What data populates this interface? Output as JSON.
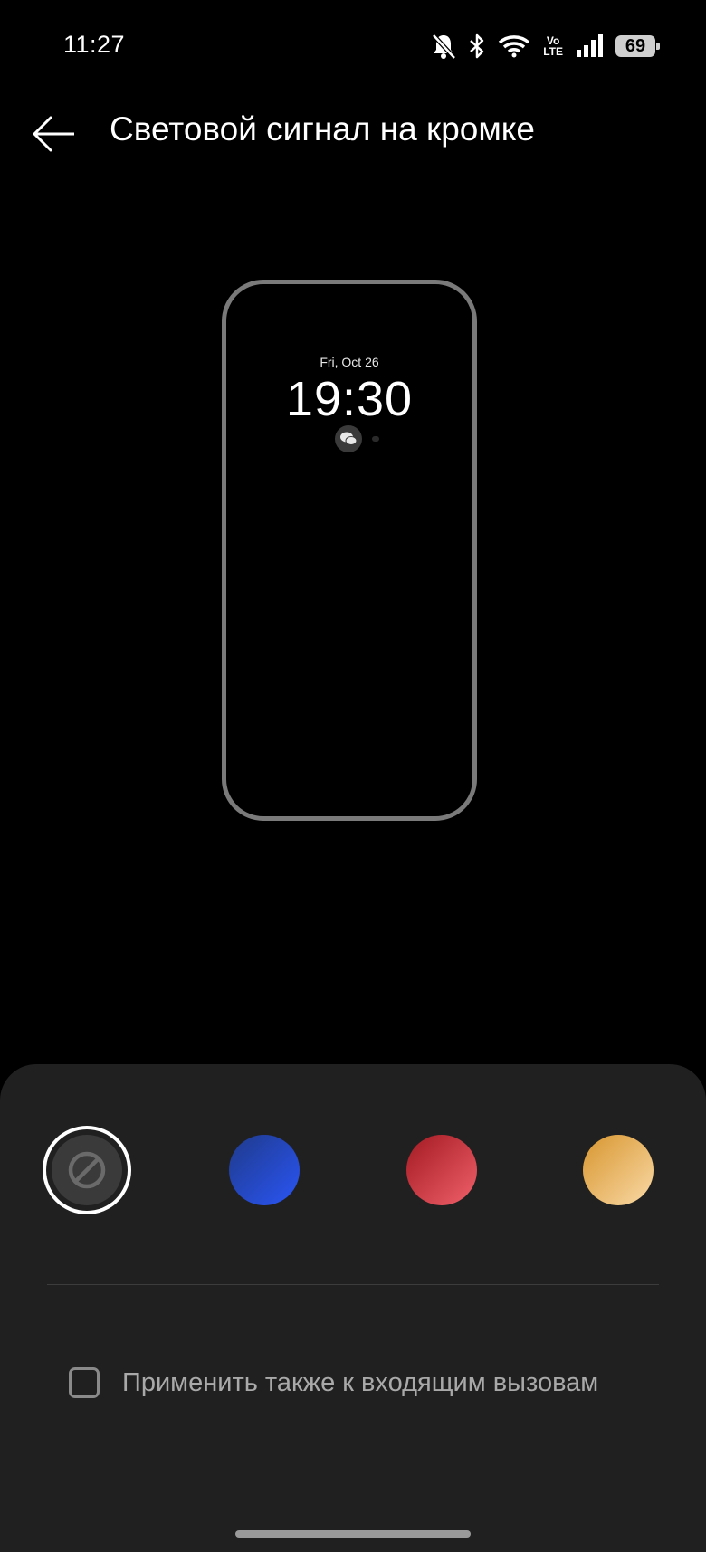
{
  "status_bar": {
    "time": "11:27",
    "volte_top": "Vo",
    "volte_bottom": "LTE",
    "battery": "69",
    "icons": [
      "bell-muted-icon",
      "bluetooth-icon",
      "wifi-icon",
      "volte-icon",
      "signal-icon",
      "battery-icon"
    ]
  },
  "header": {
    "back_icon": "arrow-left-icon",
    "title": "Световой сигнал на кромке"
  },
  "preview": {
    "date": "Fri, Oct 26",
    "clock": "19:30",
    "notification_icon": "wechat-icon"
  },
  "color_options": [
    {
      "name": "none",
      "icon": "disabled-icon",
      "selected": true
    },
    {
      "name": "blue",
      "colors": [
        "#1f3a8a",
        "#2a55f5"
      ],
      "selected": false
    },
    {
      "name": "red",
      "colors": [
        "#a31a22",
        "#f0606a"
      ],
      "selected": false
    },
    {
      "name": "gold",
      "colors": [
        "#d8962f",
        "#f9d9a6"
      ],
      "selected": false
    }
  ],
  "incoming_calls": {
    "label": "Применить также к входящим вызовам",
    "checked": false
  },
  "theme": {
    "background": "#000000",
    "sheet": "#202020",
    "text": "#ffffff",
    "muted_text": "#a9a9a9"
  }
}
